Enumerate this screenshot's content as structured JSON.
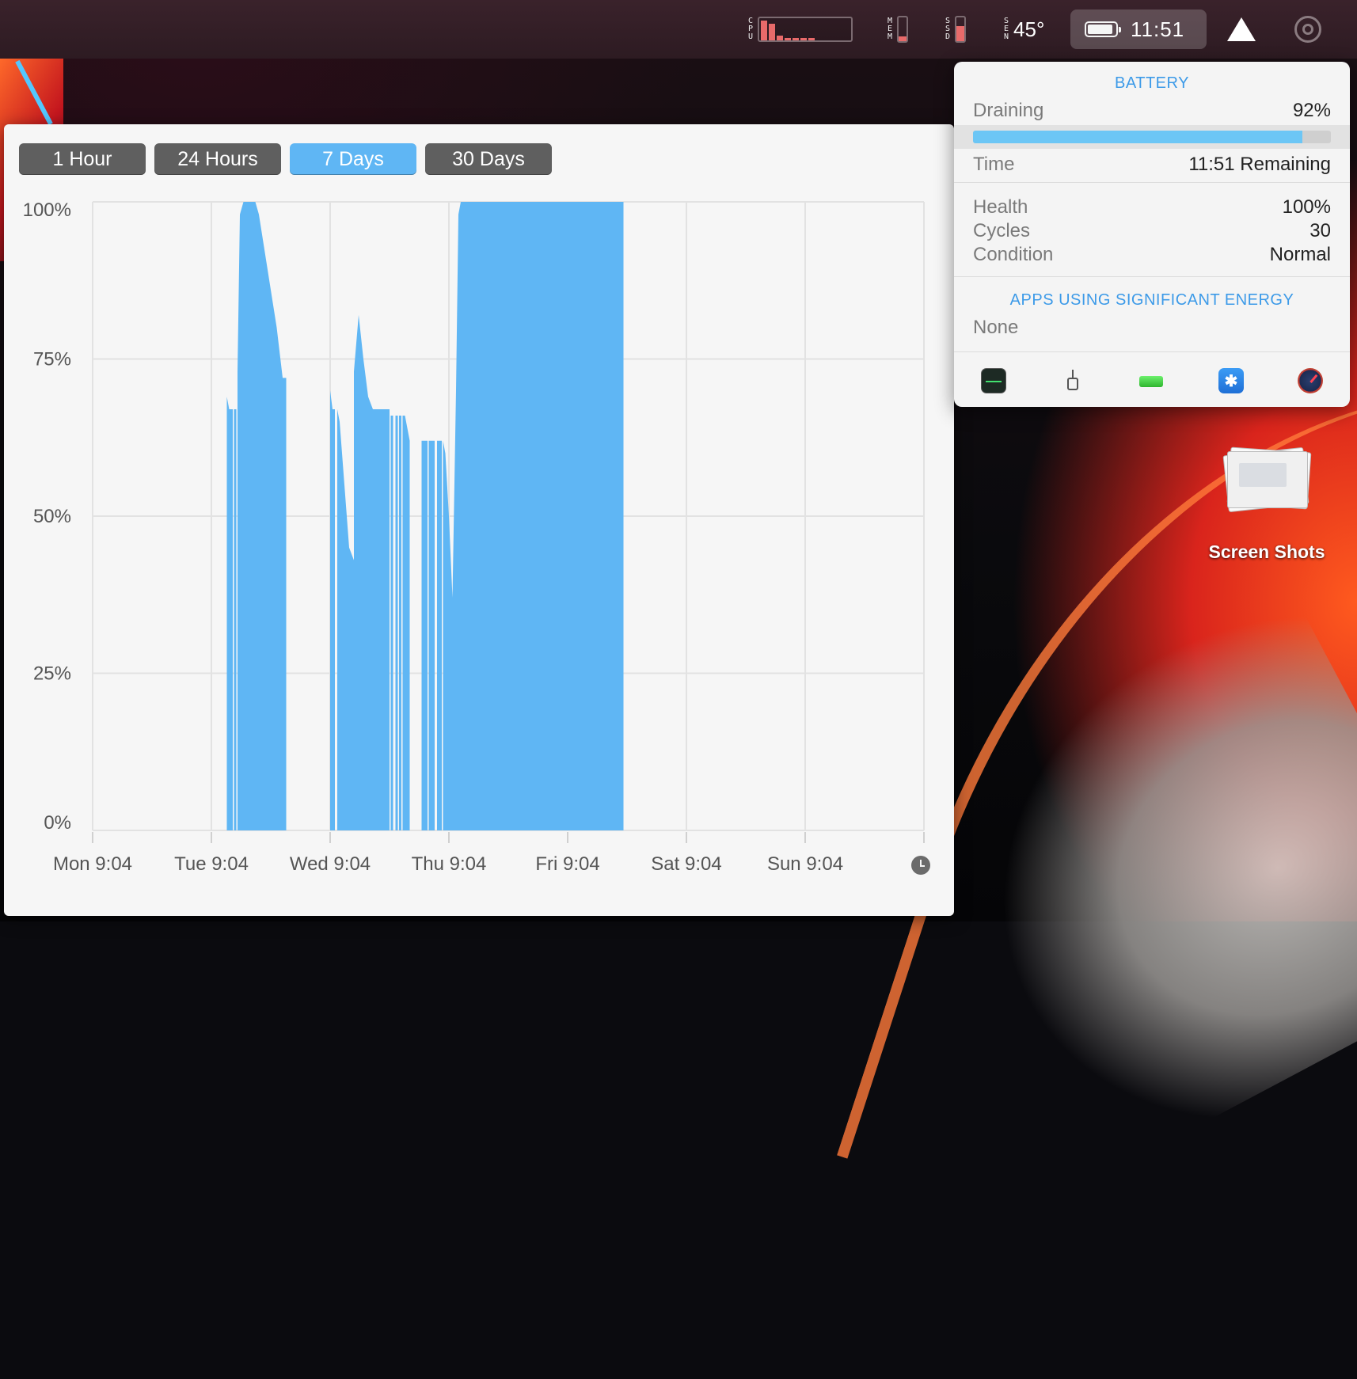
{
  "menubar": {
    "cpu_label": [
      "C",
      "P",
      "U"
    ],
    "cpu_bars": [
      0.9,
      0.75,
      0.2,
      0.12,
      0.1,
      0.1,
      0.1
    ],
    "mem_label": [
      "M",
      "E",
      "M"
    ],
    "mem_level": 0.2,
    "ssd_label": [
      "S",
      "S",
      "D"
    ],
    "ssd_level": 0.65,
    "sen_label": [
      "S",
      "E",
      "N"
    ],
    "sen_temp": "45°",
    "battery_time": "11:51",
    "battery_level": 0.92,
    "warning_icon": "warning-triangle-icon",
    "radar_icon": "radar-icon"
  },
  "ranges": [
    {
      "label": "1 Hour",
      "active": false
    },
    {
      "label": "24 Hours",
      "active": false
    },
    {
      "label": "7 Days",
      "active": true
    },
    {
      "label": "30 Days",
      "active": false
    }
  ],
  "chart_data": {
    "type": "area",
    "color": "#5fb6f4",
    "ylim": [
      0,
      100
    ],
    "yticks": [
      "100%",
      "75%",
      "50%",
      "25%",
      "0%"
    ],
    "xlim": [
      0,
      7
    ],
    "xticks": [
      "Mon 9:04",
      "Tue 9:04",
      "Wed 9:04",
      "Thu 9:04",
      "Fri 9:04",
      "Sat 9:04",
      "Sun 9:04"
    ],
    "grid": true,
    "segments": [
      {
        "x": [
          1.13,
          1.15,
          1.18
        ],
        "y": [
          69,
          67,
          67
        ]
      },
      {
        "x": [
          1.19,
          1.21
        ],
        "y": [
          67,
          67
        ]
      },
      {
        "x": [
          1.22,
          1.24,
          1.27,
          1.32,
          1.37,
          1.4,
          1.55,
          1.6,
          1.63
        ],
        "y": [
          73,
          98,
          100,
          100,
          100,
          98,
          80,
          72,
          72
        ]
      },
      {
        "x": [
          2.0,
          2.02,
          2.04
        ],
        "y": [
          70,
          67,
          67
        ]
      },
      {
        "x": [
          2.06,
          2.08,
          2.12,
          2.16,
          2.2
        ],
        "y": [
          67,
          65,
          55,
          45,
          43
        ]
      },
      {
        "x": [
          2.2,
          2.24,
          2.28,
          2.32,
          2.36
        ],
        "y": [
          73,
          82,
          75,
          69,
          67
        ]
      },
      {
        "x": [
          2.36,
          2.5
        ],
        "y": [
          67,
          67
        ]
      },
      {
        "x": [
          2.51,
          2.53
        ],
        "y": [
          66,
          66
        ]
      },
      {
        "x": [
          2.55,
          2.57
        ],
        "y": [
          66,
          66
        ]
      },
      {
        "x": [
          2.58,
          2.6
        ],
        "y": [
          66,
          66
        ]
      },
      {
        "x": [
          2.61,
          2.63,
          2.67
        ],
        "y": [
          66,
          66,
          62
        ]
      },
      {
        "x": [
          2.77,
          2.82
        ],
        "y": [
          62,
          62
        ]
      },
      {
        "x": [
          2.83,
          2.88
        ],
        "y": [
          62,
          62
        ]
      },
      {
        "x": [
          2.9,
          2.94
        ],
        "y": [
          62,
          62
        ]
      },
      {
        "x": [
          2.95,
          2.97,
          3.0,
          3.03
        ],
        "y": [
          62,
          60,
          50,
          37
        ]
      },
      {
        "x": [
          3.03,
          3.06,
          3.08,
          3.1,
          3.2,
          3.5,
          3.9,
          4.47
        ],
        "y": [
          37,
          70,
          98,
          100,
          100,
          100,
          100,
          100
        ]
      }
    ]
  },
  "popover": {
    "battery_header": "BATTERY",
    "draining_label": "Draining",
    "draining_value": "92%",
    "level": 0.92,
    "time_label": "Time",
    "time_value": "11:51 Remaining",
    "health_label": "Health",
    "health_value": "100%",
    "cycles_label": "Cycles",
    "cycles_value": "30",
    "condition_label": "Condition",
    "condition_value": "Normal",
    "apps_header": "APPS USING SIGNIFICANT ENERGY",
    "apps_value": "None",
    "footer_icons": [
      "activity-monitor-icon",
      "usb-icon",
      "battery-icon",
      "bluetooth-icon",
      "speedometer-icon"
    ]
  },
  "desktop": {
    "folder_label": "Screen Shots"
  }
}
